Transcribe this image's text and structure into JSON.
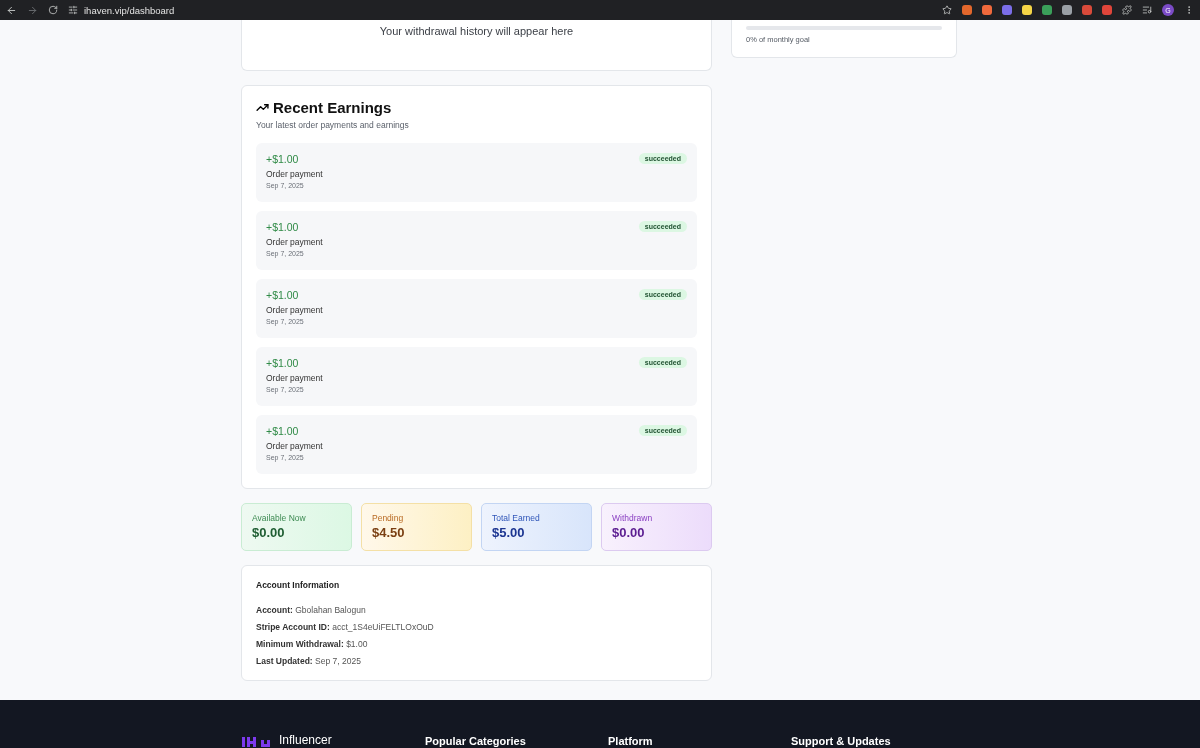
{
  "browser": {
    "url": "ihaven.vip/dashboard",
    "profile_initial": "G"
  },
  "withdrawal_history": {
    "empty_text": "Your withdrawal history will appear here"
  },
  "monthly_goal": {
    "level": 0,
    "caption": "0% of monthly goal"
  },
  "recent_earnings": {
    "title": "Recent Earnings",
    "subtitle": "Your latest order payments and earnings",
    "items": [
      {
        "amount": "+$1.00",
        "description": "Order payment",
        "date": "Sep 7, 2025",
        "status": "succeeded"
      },
      {
        "amount": "+$1.00",
        "description": "Order payment",
        "date": "Sep 7, 2025",
        "status": "succeeded"
      },
      {
        "amount": "+$1.00",
        "description": "Order payment",
        "date": "Sep 7, 2025",
        "status": "succeeded"
      },
      {
        "amount": "+$1.00",
        "description": "Order payment",
        "date": "Sep 7, 2025",
        "status": "succeeded"
      },
      {
        "amount": "+$1.00",
        "description": "Order payment",
        "date": "Sep 7, 2025",
        "status": "succeeded"
      }
    ]
  },
  "stats": [
    {
      "kind": "green",
      "label": "Available Now",
      "value": "$0.00"
    },
    {
      "kind": "amber",
      "label": "Pending",
      "value": "$4.50"
    },
    {
      "kind": "blue",
      "label": "Total Earned",
      "value": "$5.00"
    },
    {
      "kind": "purple",
      "label": "Withdrawn",
      "value": "$0.00"
    }
  ],
  "account_information": {
    "title": "Account Information",
    "fields": [
      {
        "label": "Account:",
        "value": "Gbolahan Balogun"
      },
      {
        "label": "Stripe Account ID:",
        "value": "acct_1S4eUiFELTLOxOuD"
      },
      {
        "label": "Minimum Withdrawal:",
        "value": "$1.00"
      },
      {
        "label": "Last Updated:",
        "value": "Sep 7, 2025"
      }
    ]
  },
  "footer": {
    "logo_text": "Influencer",
    "columns": [
      "Popular Categories",
      "Platform",
      "Support & Updates"
    ]
  }
}
